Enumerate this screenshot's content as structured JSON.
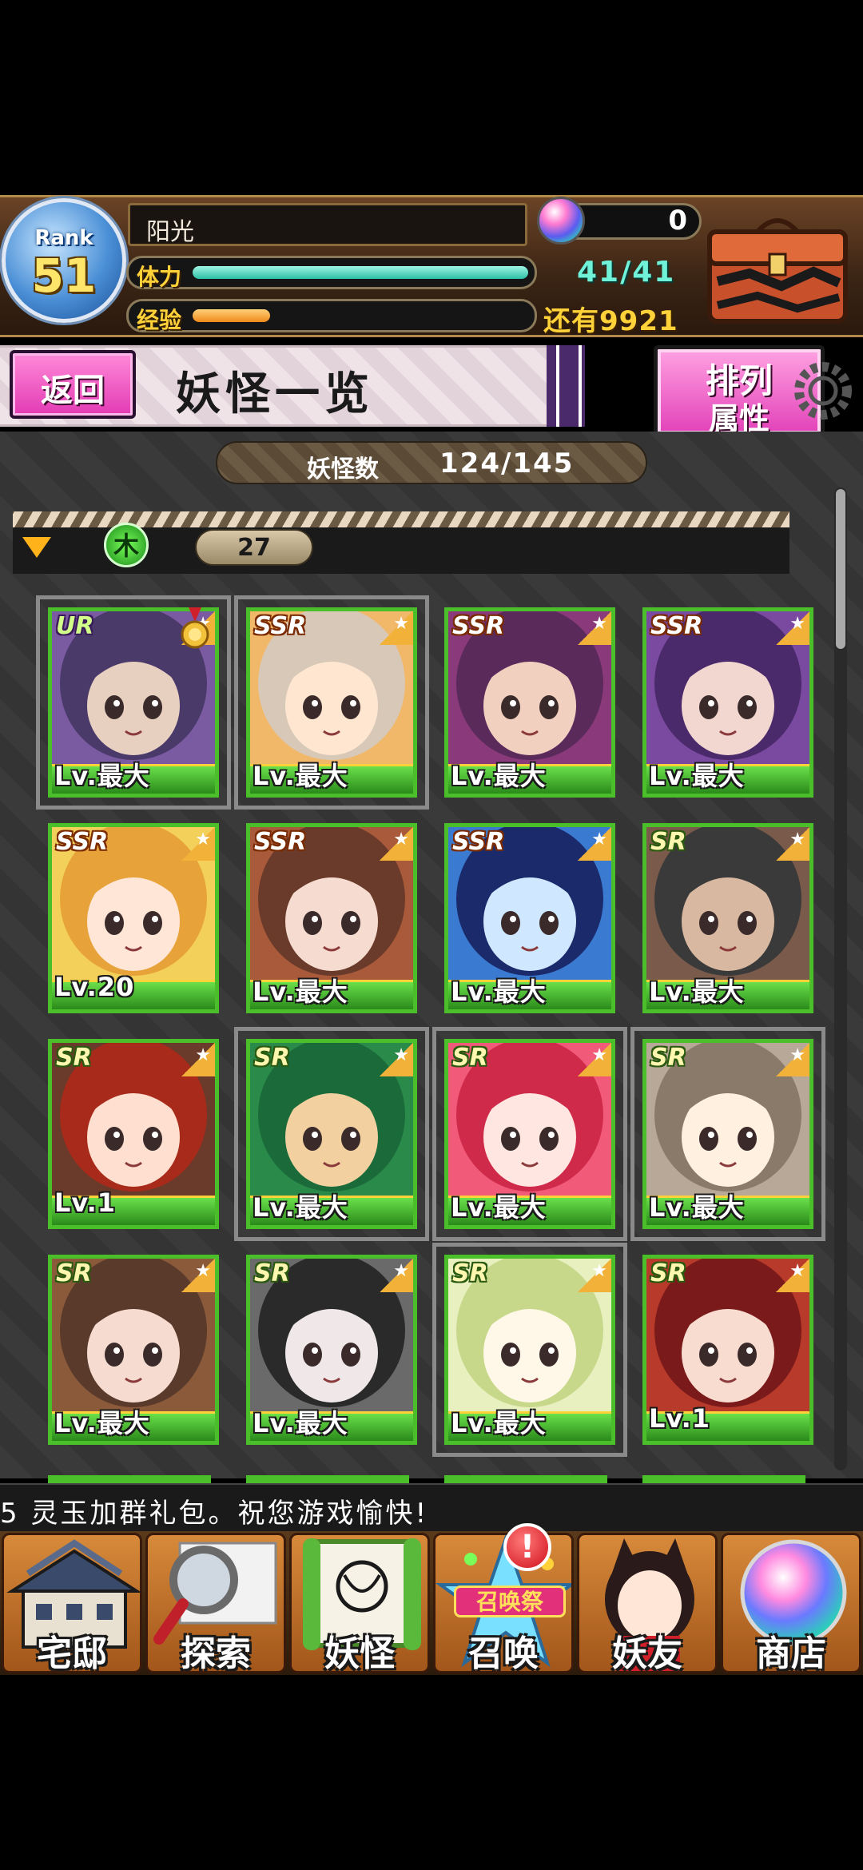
{
  "player": {
    "rank_label": "Rank",
    "rank": "51",
    "name": "阳光",
    "stamina_label": "体力",
    "stamina_text": "41/41",
    "stamina_fraction": 1.0,
    "exp_label": "经验",
    "exp_fraction": 0.23,
    "exp_remaining_text": "还有9921",
    "gems": "0"
  },
  "header": {
    "back_label": "返回",
    "title": "妖怪一览",
    "sort_line1": "排列",
    "sort_line2": "属性"
  },
  "collection": {
    "count_label": "妖怪数",
    "count_value": "124/145"
  },
  "group": {
    "attribute_icon_text": "木",
    "count": "27"
  },
  "cards": [
    {
      "rarity": "UR",
      "level": "Lv.最大",
      "medal": true,
      "selected": true,
      "colors": [
        "#4a3a6a",
        "#7a5aa0",
        "#e8d0c0"
      ]
    },
    {
      "rarity": "SSR",
      "level": "Lv.最大",
      "medal": false,
      "selected": true,
      "colors": [
        "#d8c8b8",
        "#f2b86a",
        "#ffe6d0"
      ]
    },
    {
      "rarity": "SSR",
      "level": "Lv.最大",
      "medal": false,
      "selected": false,
      "colors": [
        "#5a2a5a",
        "#8a3a7a",
        "#f2d0c0"
      ]
    },
    {
      "rarity": "SSR",
      "level": "Lv.最大",
      "medal": false,
      "selected": false,
      "colors": [
        "#4a2a6a",
        "#7a4aa0",
        "#f2d6d0"
      ]
    },
    {
      "rarity": "SSR",
      "level": "Lv.20",
      "medal": false,
      "selected": false,
      "colors": [
        "#e8a23a",
        "#f2d05a",
        "#ffe6d6"
      ]
    },
    {
      "rarity": "SSR",
      "level": "Lv.最大",
      "medal": false,
      "selected": false,
      "colors": [
        "#6a3a2a",
        "#a85a3a",
        "#f6dcd0"
      ]
    },
    {
      "rarity": "SSR",
      "level": "Lv.最大",
      "medal": false,
      "selected": false,
      "colors": [
        "#1a2a6a",
        "#3a7ad0",
        "#d0e8ff"
      ]
    },
    {
      "rarity": "SR",
      "level": "Lv.最大",
      "medal": false,
      "selected": false,
      "colors": [
        "#3a3a3a",
        "#7a5a4a",
        "#d8b8a0"
      ]
    },
    {
      "rarity": "SR",
      "level": "Lv.1",
      "medal": false,
      "selected": false,
      "colors": [
        "#a82a1a",
        "#6a3a2a",
        "#ffe0d0"
      ]
    },
    {
      "rarity": "SR",
      "level": "Lv.最大",
      "medal": false,
      "selected": true,
      "colors": [
        "#1a6a3a",
        "#2a8a4a",
        "#f2d0a0"
      ]
    },
    {
      "rarity": "SR",
      "level": "Lv.最大",
      "medal": false,
      "selected": true,
      "colors": [
        "#d02a4a",
        "#f25a7a",
        "#ffe6e0"
      ]
    },
    {
      "rarity": "SR",
      "level": "Lv.最大",
      "medal": false,
      "selected": true,
      "colors": [
        "#8a7a6a",
        "#b8a898",
        "#fff0e0"
      ]
    },
    {
      "rarity": "SR",
      "level": "Lv.最大",
      "medal": false,
      "selected": false,
      "colors": [
        "#5a3a2a",
        "#8a5a3a",
        "#f6dcd0"
      ]
    },
    {
      "rarity": "SR",
      "level": "Lv.最大",
      "medal": false,
      "selected": false,
      "colors": [
        "#2a2a2a",
        "#6a6a6a",
        "#f0e8e8"
      ]
    },
    {
      "rarity": "SR",
      "level": "Lv.最大",
      "medal": false,
      "selected": true,
      "colors": [
        "#c8d88a",
        "#e8f0c0",
        "#fff8e8"
      ]
    },
    {
      "rarity": "SR",
      "level": "Lv.1",
      "medal": false,
      "selected": false,
      "colors": [
        "#7a1a1a",
        "#b83a2a",
        "#f8dcd0"
      ]
    }
  ],
  "ticker": {
    "text": "5 灵玉加群礼包。祝您游戏愉快!"
  },
  "nav": [
    {
      "label": "宅邸",
      "icon": "mansion-icon"
    },
    {
      "label": "探索",
      "icon": "magnifier-map-icon"
    },
    {
      "label": "妖怪",
      "icon": "scroll-icon"
    },
    {
      "label": "召唤",
      "icon": "summon-star-icon",
      "sub_label": "召唤祭",
      "badge": "!"
    },
    {
      "label": "妖友",
      "icon": "friend-catgirl-icon"
    },
    {
      "label": "商店",
      "icon": "crystal-orb-icon"
    }
  ],
  "colors": {
    "accent_pink": "#e23ab4",
    "card_green": "#4abf2a",
    "gold": "#ffd23a",
    "stamina": "#2dbfa6"
  }
}
